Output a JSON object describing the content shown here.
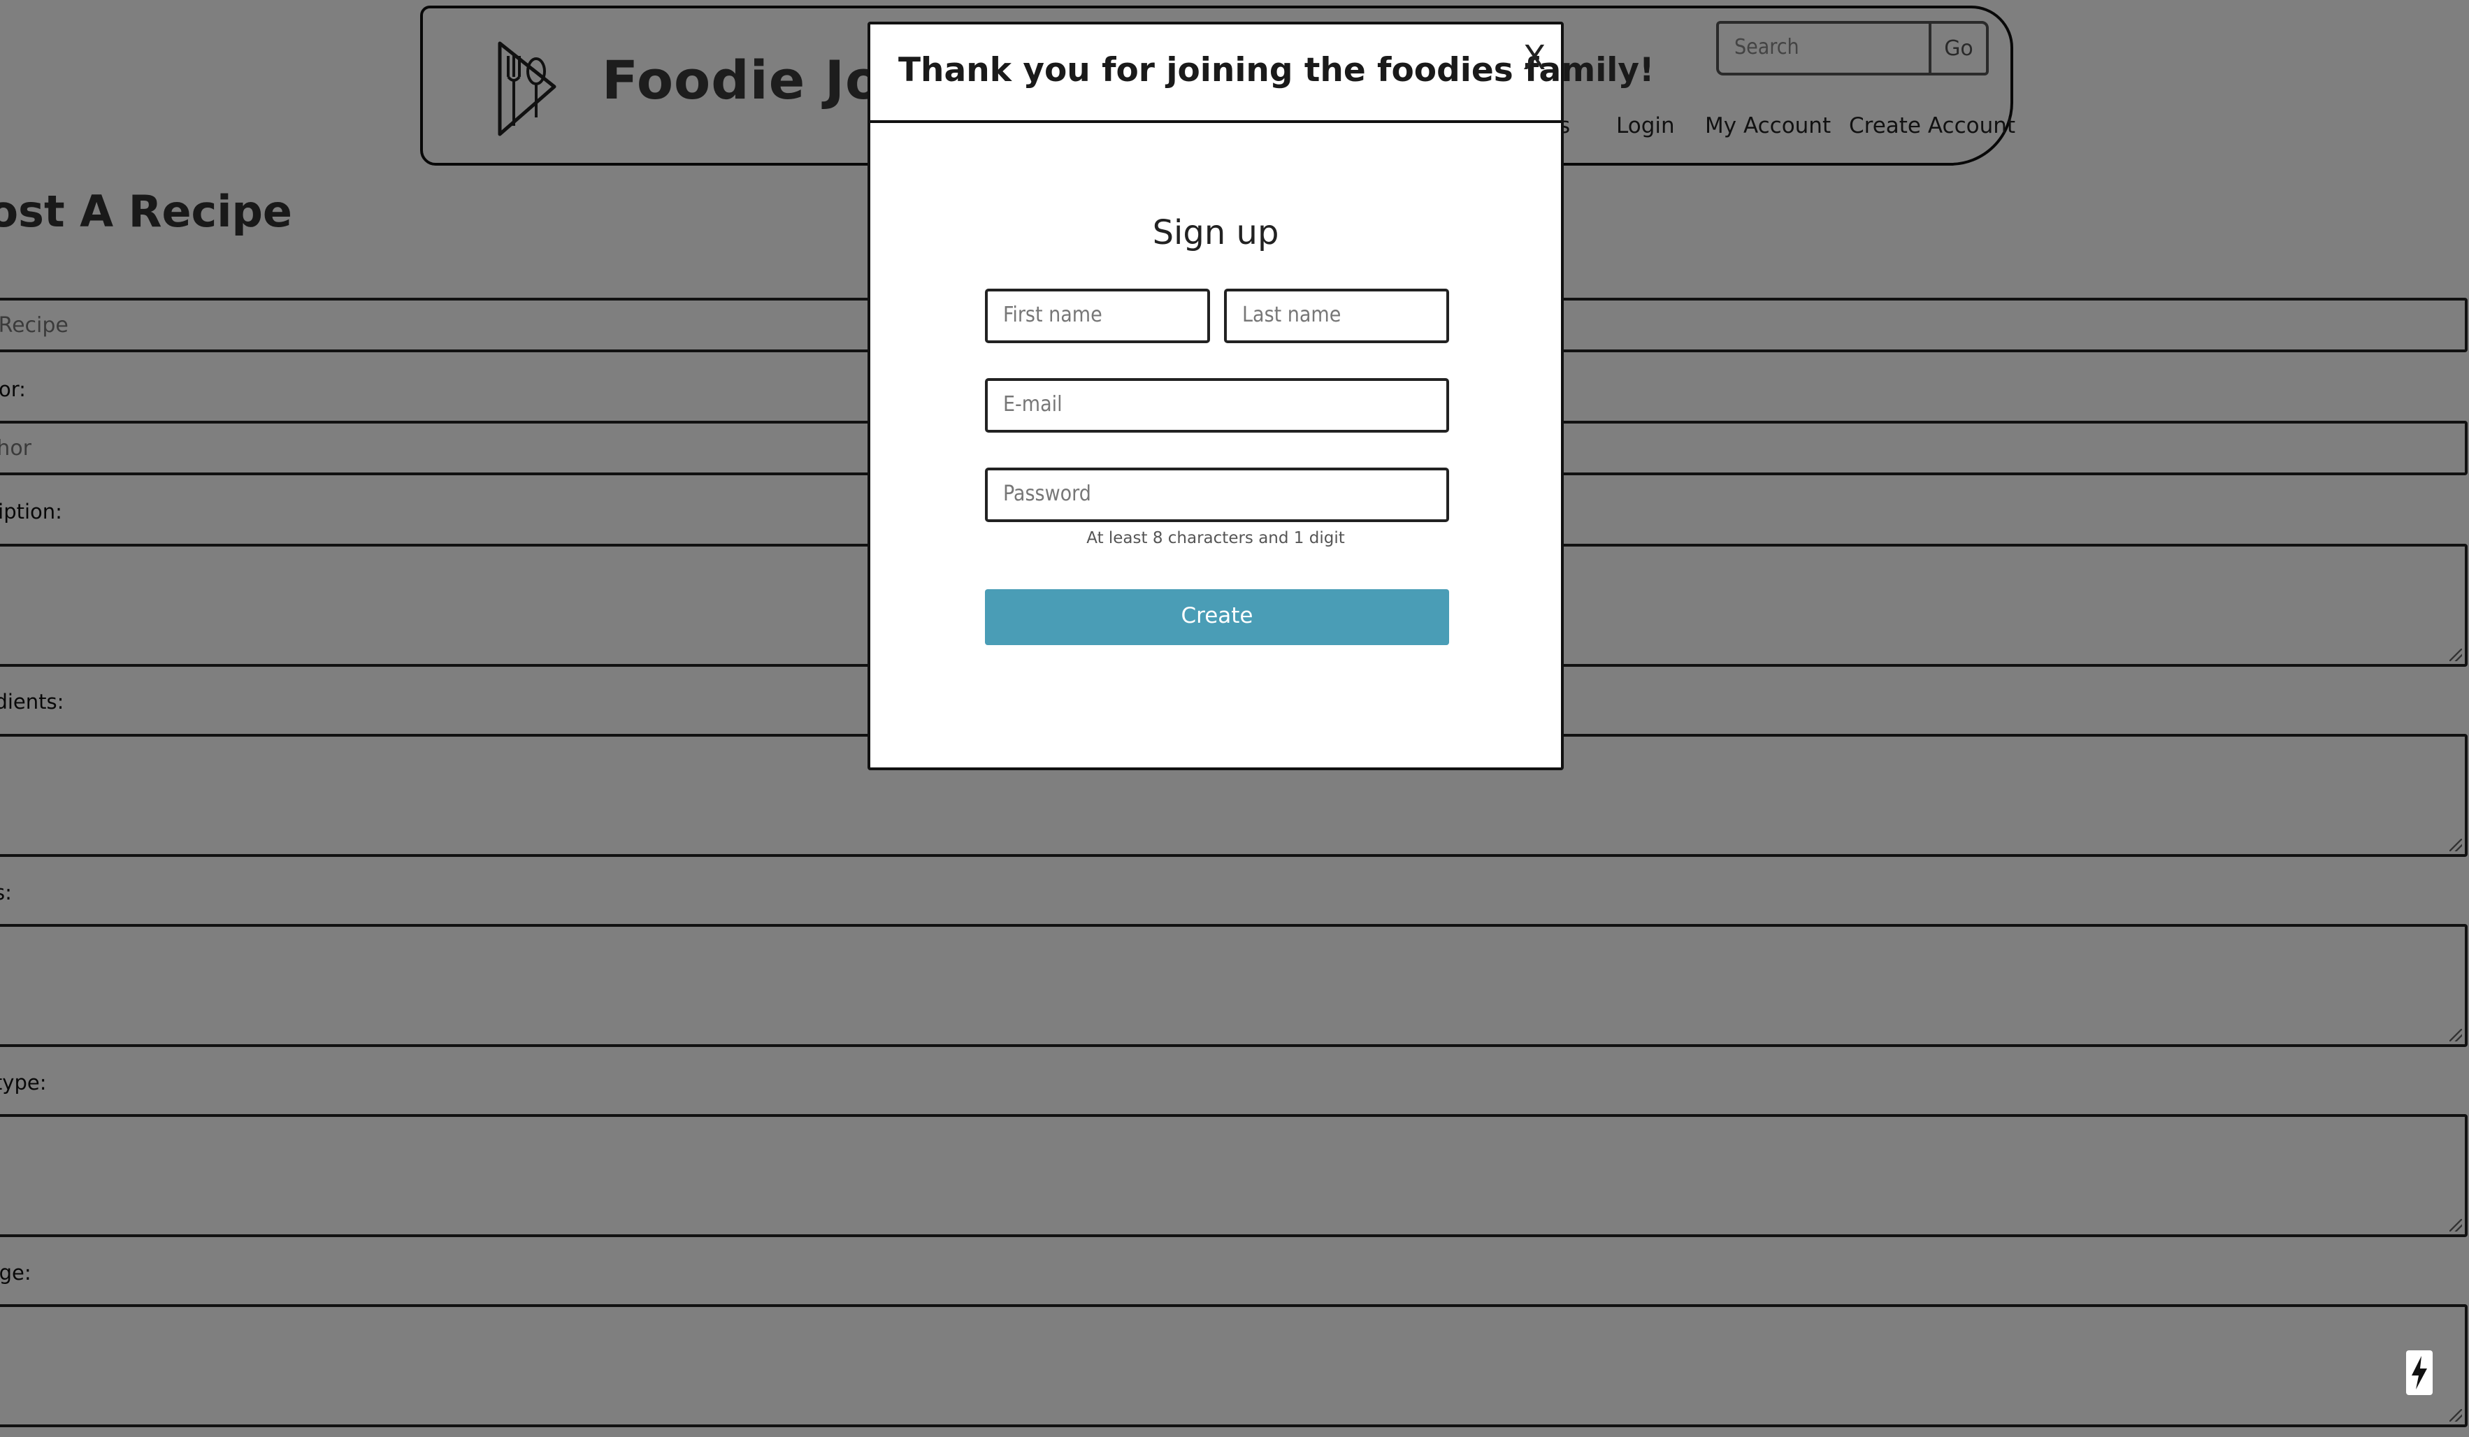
{
  "header": {
    "brand": "Foodie Journal",
    "search_placeholder": "Search",
    "search_button": "Go",
    "nav": {
      "partial_item": "s",
      "login": "Login",
      "my_account": "My Account",
      "create_account": "Create Account"
    }
  },
  "page": {
    "title": "Post A Recipe",
    "fields": {
      "recipe_placeholder": "Your Recipe",
      "author_label": "Author:",
      "author_placeholder": "Author",
      "description_label": "Description:",
      "ingredients_label": "Ingredients:",
      "steps_label": "Steps:",
      "meal_type_label": "Meal type:",
      "image_label": "Image:"
    }
  },
  "modal": {
    "title": "Thank you for joining the foodies family!",
    "close_label": "X",
    "signup_title": "Sign up",
    "first_name_placeholder": "First name",
    "last_name_placeholder": "Last name",
    "email_placeholder": "E-mail",
    "password_placeholder": "Password",
    "password_hint": "At least 8 characters and 1 digit",
    "create_button": "Create"
  },
  "colors": {
    "create_button": "#4a9db6",
    "overlay": "rgba(0,0,0,0.5)"
  },
  "icons": {
    "logo": "fork-knife-spoon-icon",
    "badge": "lightning-icon"
  }
}
